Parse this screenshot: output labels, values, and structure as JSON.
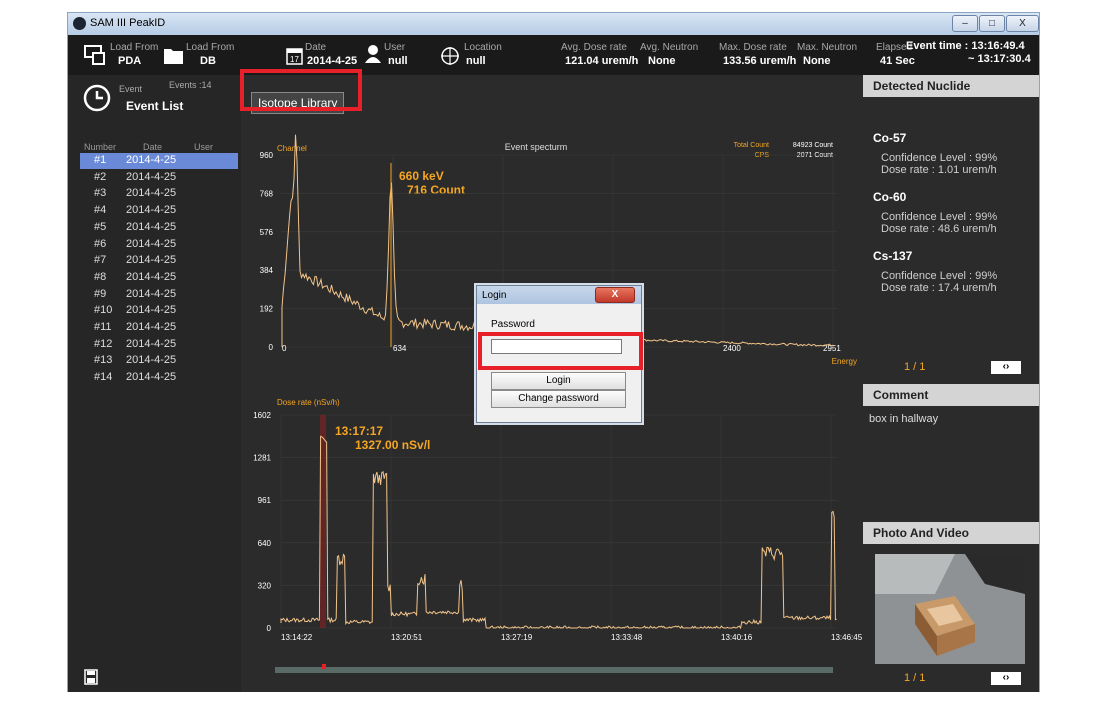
{
  "window": {
    "title": "SAM III PeakID",
    "min": "–",
    "max": "□",
    "close": "X"
  },
  "toolbar": {
    "load_pda_label": "Load From",
    "load_pda_value": "PDA",
    "load_db_label": "Load From",
    "load_db_value": "DB",
    "date_label": "Date",
    "date_value": "2014-4-25",
    "calendar_day": "17",
    "user_label": "User",
    "user_value": "null",
    "location_label": "Location",
    "location_value": "null",
    "avg_dose_label": "Avg. Dose rate",
    "avg_dose_value": "121.04 urem/h",
    "avg_neutron_label": "Avg. Neutron",
    "avg_neutron_value": "None",
    "max_dose_label": "Max. Dose rate",
    "max_dose_value": "133.56 urem/h",
    "max_neutron_label": "Max. Neutron",
    "max_neutron_value": "None",
    "elapsed_label": "Elapsed",
    "elapsed_value": "41 Sec",
    "event_time_label": "Event time : 13:16:49.4",
    "event_time_end": "~ 13:17:30.4"
  },
  "event_panel": {
    "label": "Event",
    "count": "Events :14",
    "title": "Event List",
    "col_number": "Number",
    "col_date": "Date",
    "col_user": "User",
    "rows": [
      {
        "num": "#1",
        "date": "2014-4-25"
      },
      {
        "num": "#2",
        "date": "2014-4-25"
      },
      {
        "num": "#3",
        "date": "2014-4-25"
      },
      {
        "num": "#4",
        "date": "2014-4-25"
      },
      {
        "num": "#5",
        "date": "2014-4-25"
      },
      {
        "num": "#6",
        "date": "2014-4-25"
      },
      {
        "num": "#7",
        "date": "2014-4-25"
      },
      {
        "num": "#8",
        "date": "2014-4-25"
      },
      {
        "num": "#9",
        "date": "2014-4-25"
      },
      {
        "num": "#10",
        "date": "2014-4-25"
      },
      {
        "num": "#11",
        "date": "2014-4-25"
      },
      {
        "num": "#12",
        "date": "2014-4-25"
      },
      {
        "num": "#13",
        "date": "2014-4-25"
      },
      {
        "num": "#14",
        "date": "2014-4-25"
      }
    ]
  },
  "isotope_library_button": "Isotope Library",
  "spectrum": {
    "title": "Event specturm",
    "ylabel": "Channel",
    "xlabel": "Energy",
    "total_count_label": "Total Count",
    "total_count_value": "84923 Count",
    "cps_label": "CPS",
    "cps_value": "2071 Count",
    "peak_energy": "660 keV",
    "peak_count": "716 Count",
    "yticks": [
      "960",
      "768",
      "576",
      "384",
      "192",
      "0"
    ],
    "xticks": [
      "0",
      "634",
      "2400",
      "2951"
    ]
  },
  "dose": {
    "ylabel": "Dose rate (nSv/h)",
    "cursor_time": "13:17:17",
    "cursor_value": "1327.00 nSv/l",
    "yticks": [
      "1602",
      "1281",
      "961",
      "640",
      "320",
      "0"
    ],
    "xticks": [
      "13:14:22",
      "13:20:51",
      "13:27:19",
      "13:33:48",
      "13:40:16",
      "13:46:45"
    ]
  },
  "login_dialog": {
    "title": "Login",
    "close": "X",
    "password_label": "Password",
    "password_value": "",
    "login_button": "Login",
    "change_password_button": "Change password"
  },
  "detected_nuclide": {
    "header": "Detected Nuclide",
    "items": [
      {
        "name": "Co-57",
        "confidence": "Confidence Level : 99%",
        "dose": "Dose rate : 1.01 urem/h"
      },
      {
        "name": "Co-60",
        "confidence": "Confidence Level : 99%",
        "dose": "Dose rate : 48.6 urem/h"
      },
      {
        "name": "Cs-137",
        "confidence": "Confidence Level : 99%",
        "dose": "Dose rate : 17.4 urem/h"
      }
    ],
    "page": "1 / 1"
  },
  "comment": {
    "header": "Comment",
    "text": "box in hallway"
  },
  "photo": {
    "header": "Photo And Video",
    "page": "1 / 1"
  },
  "colors": {
    "accent": "#f5a623",
    "selected_row": "#6a8ad8",
    "highlight": "#e8202a"
  }
}
